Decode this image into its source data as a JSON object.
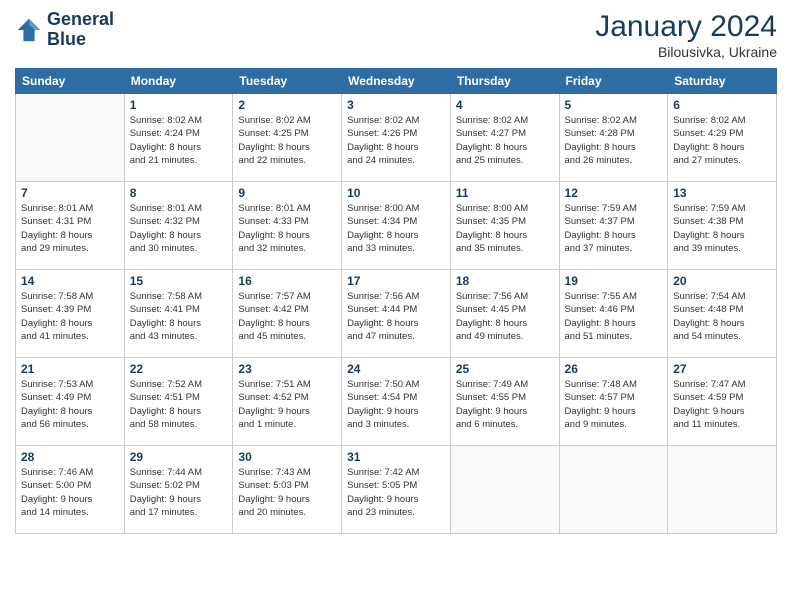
{
  "header": {
    "logo_line1": "General",
    "logo_line2": "Blue",
    "month_year": "January 2024",
    "location": "Bilousivka, Ukraine"
  },
  "weekdays": [
    "Sunday",
    "Monday",
    "Tuesday",
    "Wednesday",
    "Thursday",
    "Friday",
    "Saturday"
  ],
  "weeks": [
    [
      {
        "day": "",
        "info": ""
      },
      {
        "day": "1",
        "info": "Sunrise: 8:02 AM\nSunset: 4:24 PM\nDaylight: 8 hours\nand 21 minutes."
      },
      {
        "day": "2",
        "info": "Sunrise: 8:02 AM\nSunset: 4:25 PM\nDaylight: 8 hours\nand 22 minutes."
      },
      {
        "day": "3",
        "info": "Sunrise: 8:02 AM\nSunset: 4:26 PM\nDaylight: 8 hours\nand 24 minutes."
      },
      {
        "day": "4",
        "info": "Sunrise: 8:02 AM\nSunset: 4:27 PM\nDaylight: 8 hours\nand 25 minutes."
      },
      {
        "day": "5",
        "info": "Sunrise: 8:02 AM\nSunset: 4:28 PM\nDaylight: 8 hours\nand 26 minutes."
      },
      {
        "day": "6",
        "info": "Sunrise: 8:02 AM\nSunset: 4:29 PM\nDaylight: 8 hours\nand 27 minutes."
      }
    ],
    [
      {
        "day": "7",
        "info": "Sunrise: 8:01 AM\nSunset: 4:31 PM\nDaylight: 8 hours\nand 29 minutes."
      },
      {
        "day": "8",
        "info": "Sunrise: 8:01 AM\nSunset: 4:32 PM\nDaylight: 8 hours\nand 30 minutes."
      },
      {
        "day": "9",
        "info": "Sunrise: 8:01 AM\nSunset: 4:33 PM\nDaylight: 8 hours\nand 32 minutes."
      },
      {
        "day": "10",
        "info": "Sunrise: 8:00 AM\nSunset: 4:34 PM\nDaylight: 8 hours\nand 33 minutes."
      },
      {
        "day": "11",
        "info": "Sunrise: 8:00 AM\nSunset: 4:35 PM\nDaylight: 8 hours\nand 35 minutes."
      },
      {
        "day": "12",
        "info": "Sunrise: 7:59 AM\nSunset: 4:37 PM\nDaylight: 8 hours\nand 37 minutes."
      },
      {
        "day": "13",
        "info": "Sunrise: 7:59 AM\nSunset: 4:38 PM\nDaylight: 8 hours\nand 39 minutes."
      }
    ],
    [
      {
        "day": "14",
        "info": "Sunrise: 7:58 AM\nSunset: 4:39 PM\nDaylight: 8 hours\nand 41 minutes."
      },
      {
        "day": "15",
        "info": "Sunrise: 7:58 AM\nSunset: 4:41 PM\nDaylight: 8 hours\nand 43 minutes."
      },
      {
        "day": "16",
        "info": "Sunrise: 7:57 AM\nSunset: 4:42 PM\nDaylight: 8 hours\nand 45 minutes."
      },
      {
        "day": "17",
        "info": "Sunrise: 7:56 AM\nSunset: 4:44 PM\nDaylight: 8 hours\nand 47 minutes."
      },
      {
        "day": "18",
        "info": "Sunrise: 7:56 AM\nSunset: 4:45 PM\nDaylight: 8 hours\nand 49 minutes."
      },
      {
        "day": "19",
        "info": "Sunrise: 7:55 AM\nSunset: 4:46 PM\nDaylight: 8 hours\nand 51 minutes."
      },
      {
        "day": "20",
        "info": "Sunrise: 7:54 AM\nSunset: 4:48 PM\nDaylight: 8 hours\nand 54 minutes."
      }
    ],
    [
      {
        "day": "21",
        "info": "Sunrise: 7:53 AM\nSunset: 4:49 PM\nDaylight: 8 hours\nand 56 minutes."
      },
      {
        "day": "22",
        "info": "Sunrise: 7:52 AM\nSunset: 4:51 PM\nDaylight: 8 hours\nand 58 minutes."
      },
      {
        "day": "23",
        "info": "Sunrise: 7:51 AM\nSunset: 4:52 PM\nDaylight: 9 hours\nand 1 minute."
      },
      {
        "day": "24",
        "info": "Sunrise: 7:50 AM\nSunset: 4:54 PM\nDaylight: 9 hours\nand 3 minutes."
      },
      {
        "day": "25",
        "info": "Sunrise: 7:49 AM\nSunset: 4:55 PM\nDaylight: 9 hours\nand 6 minutes."
      },
      {
        "day": "26",
        "info": "Sunrise: 7:48 AM\nSunset: 4:57 PM\nDaylight: 9 hours\nand 9 minutes."
      },
      {
        "day": "27",
        "info": "Sunrise: 7:47 AM\nSunset: 4:59 PM\nDaylight: 9 hours\nand 11 minutes."
      }
    ],
    [
      {
        "day": "28",
        "info": "Sunrise: 7:46 AM\nSunset: 5:00 PM\nDaylight: 9 hours\nand 14 minutes."
      },
      {
        "day": "29",
        "info": "Sunrise: 7:44 AM\nSunset: 5:02 PM\nDaylight: 9 hours\nand 17 minutes."
      },
      {
        "day": "30",
        "info": "Sunrise: 7:43 AM\nSunset: 5:03 PM\nDaylight: 9 hours\nand 20 minutes."
      },
      {
        "day": "31",
        "info": "Sunrise: 7:42 AM\nSunset: 5:05 PM\nDaylight: 9 hours\nand 23 minutes."
      },
      {
        "day": "",
        "info": ""
      },
      {
        "day": "",
        "info": ""
      },
      {
        "day": "",
        "info": ""
      }
    ]
  ]
}
